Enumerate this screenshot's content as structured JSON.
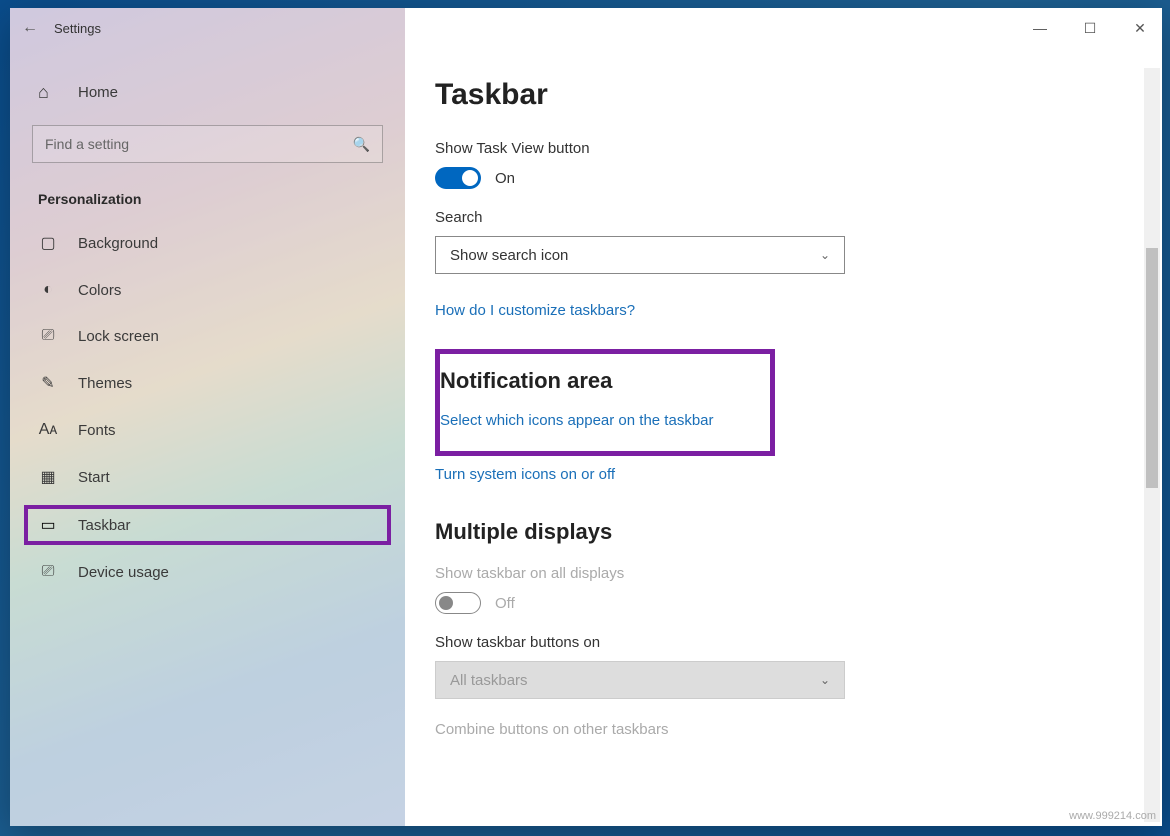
{
  "app": {
    "title": "Settings"
  },
  "window_controls": {
    "minimize": "—",
    "maximize": "☐",
    "close": "✕"
  },
  "sidebar": {
    "home_label": "Home",
    "search_placeholder": "Find a setting",
    "category": "Personalization",
    "items": [
      {
        "icon": "background-icon",
        "glyph": "▢",
        "label": "Background"
      },
      {
        "icon": "colors-icon",
        "glyph": "◐",
        "label": "Colors"
      },
      {
        "icon": "lockscreen-icon",
        "glyph": "⎚",
        "label": "Lock screen"
      },
      {
        "icon": "themes-icon",
        "glyph": "✎",
        "label": "Themes"
      },
      {
        "icon": "fonts-icon",
        "glyph": "Aᴀ",
        "label": "Fonts"
      },
      {
        "icon": "start-icon",
        "glyph": "▦",
        "label": "Start"
      },
      {
        "icon": "taskbar-icon",
        "glyph": "▭",
        "label": "Taskbar"
      },
      {
        "icon": "device-usage-icon",
        "glyph": "⎚",
        "label": "Device usage"
      }
    ]
  },
  "main": {
    "heading": "Taskbar",
    "show_task_view_label": "Show Task View button",
    "show_task_view_state": "On",
    "search_label": "Search",
    "search_dropdown_value": "Show search icon",
    "help_link": "How do I customize taskbars?",
    "notification_area_heading": "Notification area",
    "select_icons_link": "Select which icons appear on the taskbar",
    "system_icons_link": "Turn system icons on or off",
    "multiple_displays_heading": "Multiple displays",
    "show_all_displays_label": "Show taskbar on all displays",
    "show_all_displays_state": "Off",
    "show_buttons_on_label": "Show taskbar buttons on",
    "show_buttons_on_value": "All taskbars",
    "combine_label": "Combine buttons on other taskbars"
  },
  "watermark": "www.999214.com"
}
